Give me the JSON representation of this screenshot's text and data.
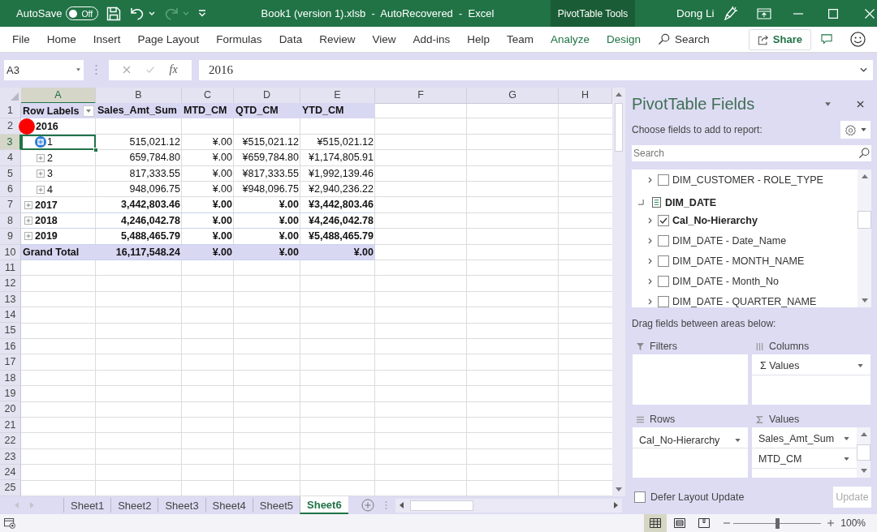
{
  "title_bar": {
    "autosave": {
      "label": "AutoSave",
      "toggle": "Off",
      "on": false
    },
    "quick_access": [
      {
        "kind": "save",
        "disabled": false
      },
      {
        "kind": "undo",
        "disabled": false
      },
      {
        "kind": "redo",
        "disabled": true
      },
      {
        "kind": "customize",
        "disabled": false
      }
    ],
    "document_title": "Book1 (version 1).xlsb  -  AutoRecovered  -  Excel",
    "context_tab": "PivotTable Tools",
    "user": "Dong Li"
  },
  "ribbon": {
    "tabs": [
      {
        "label": "File",
        "contextual": false
      },
      {
        "label": "Home",
        "contextual": false
      },
      {
        "label": "Insert",
        "contextual": false
      },
      {
        "label": "Page Layout",
        "contextual": false
      },
      {
        "label": "Formulas",
        "contextual": false
      },
      {
        "label": "Data",
        "contextual": false
      },
      {
        "label": "Review",
        "contextual": false
      },
      {
        "label": "View",
        "contextual": false
      },
      {
        "label": "Add-ins",
        "contextual": false
      },
      {
        "label": "Help",
        "contextual": false
      },
      {
        "label": "Team",
        "contextual": false
      },
      {
        "label": "Analyze",
        "contextual": true
      },
      {
        "label": "Design",
        "contextual": true
      }
    ],
    "search": "Search",
    "share": "Share"
  },
  "formula_bar": {
    "name_box": "A3",
    "function_button": "fx",
    "formula": "2016"
  },
  "sheet": {
    "columns": [
      {
        "label": "A",
        "selected": true
      },
      {
        "label": "B",
        "selected": false
      },
      {
        "label": "C",
        "selected": false
      },
      {
        "label": "D",
        "selected": false
      },
      {
        "label": "E",
        "selected": false
      },
      {
        "label": "F",
        "selected": false
      },
      {
        "label": "G",
        "selected": false
      },
      {
        "label": "H",
        "selected": false
      }
    ],
    "rows": [
      {
        "number": "1",
        "selected": false,
        "kind": "header",
        "label": "Row Labels",
        "values": [
          "Sales_Amt_Sum",
          "MTD_CM",
          "QTD_CM",
          "YTD_CM"
        ]
      },
      {
        "number": "2",
        "selected": false,
        "kind": "year",
        "label": "2016",
        "click_marker": true
      },
      {
        "number": "3",
        "selected": true,
        "kind": "quarter",
        "label": "1",
        "expanded": false,
        "hovered": true,
        "values": [
          "515,021.12",
          "¥.00",
          "¥515,021.12",
          "¥515,021.12"
        ]
      },
      {
        "number": "4",
        "selected": false,
        "kind": "quarter",
        "label": "2",
        "expanded": false,
        "hovered": false,
        "values": [
          "659,784.80",
          "¥.00",
          "¥659,784.80",
          "¥1,174,805.91"
        ]
      },
      {
        "number": "5",
        "selected": false,
        "kind": "quarter",
        "label": "3",
        "expanded": false,
        "hovered": false,
        "values": [
          "817,333.55",
          "¥.00",
          "¥817,333.55",
          "¥1,992,139.46"
        ]
      },
      {
        "number": "6",
        "selected": false,
        "kind": "quarter",
        "label": "4",
        "expanded": false,
        "hovered": false,
        "values": [
          "948,096.75",
          "¥.00",
          "¥948,096.75",
          "¥2,940,236.22"
        ]
      },
      {
        "number": "7",
        "selected": false,
        "kind": "year",
        "label": "2017",
        "expanded": false,
        "hovered": false,
        "values": [
          "3,442,803.46",
          "¥.00",
          "¥.00",
          "¥3,442,803.46"
        ]
      },
      {
        "number": "8",
        "selected": false,
        "kind": "year",
        "label": "2018",
        "expanded": false,
        "hovered": false,
        "values": [
          "4,246,042.78",
          "¥.00",
          "¥.00",
          "¥4,246,042.78"
        ]
      },
      {
        "number": "9",
        "selected": false,
        "kind": "year",
        "label": "2019",
        "expanded": false,
        "hovered": false,
        "values": [
          "5,488,465.79",
          "¥.00",
          "¥.00",
          "¥5,488,465.79"
        ]
      },
      {
        "number": "10",
        "selected": false,
        "kind": "total",
        "label": "Grand Total",
        "values": [
          "16,117,548.24",
          "¥.00",
          "¥.00",
          "¥.00"
        ]
      },
      {
        "number": "11",
        "selected": false,
        "kind": "empty"
      },
      {
        "number": "12",
        "selected": false,
        "kind": "empty"
      },
      {
        "number": "13",
        "selected": false,
        "kind": "empty"
      },
      {
        "number": "14",
        "selected": false,
        "kind": "empty"
      },
      {
        "number": "15",
        "selected": false,
        "kind": "empty"
      },
      {
        "number": "16",
        "selected": false,
        "kind": "empty"
      },
      {
        "number": "17",
        "selected": false,
        "kind": "empty"
      },
      {
        "number": "18",
        "selected": false,
        "kind": "empty"
      },
      {
        "number": "19",
        "selected": false,
        "kind": "empty"
      },
      {
        "number": "20",
        "selected": false,
        "kind": "empty"
      },
      {
        "number": "21",
        "selected": false,
        "kind": "empty"
      },
      {
        "number": "22",
        "selected": false,
        "kind": "empty"
      },
      {
        "number": "23",
        "selected": false,
        "kind": "empty"
      },
      {
        "number": "24",
        "selected": false,
        "kind": "empty"
      },
      {
        "number": "25",
        "selected": false,
        "kind": "empty"
      }
    ]
  },
  "sheet_tabs": [
    {
      "label": "Sheet1",
      "selected": false
    },
    {
      "label": "Sheet2",
      "selected": false
    },
    {
      "label": "Sheet3",
      "selected": false
    },
    {
      "label": "Sheet4",
      "selected": false
    },
    {
      "label": "Sheet5",
      "selected": false
    },
    {
      "label": "Sheet6",
      "selected": true
    }
  ],
  "pivot_pane": {
    "title": "PivotTable Fields",
    "subtitle": "Choose fields to add to report:",
    "search_placeholder": "Search",
    "fields": [
      {
        "kind": "field",
        "label": "DIM_CUSTOMER - ROLE_TYPE",
        "checked": false
      },
      {
        "kind": "table",
        "label": "DIM_DATE",
        "expanded": true,
        "children": [
          {
            "label": "Cal_No-Hierarchy",
            "checked": true
          },
          {
            "label": "DIM_DATE - Date_Name",
            "checked": false
          },
          {
            "label": "DIM_DATE - MONTH_NAME",
            "checked": false
          },
          {
            "label": "DIM_DATE - Month_No",
            "checked": false
          },
          {
            "label": "DIM_DATE - QUARTER_NAME",
            "checked": false
          }
        ]
      }
    ],
    "areas_hint": "Drag fields between areas below:",
    "areas": [
      {
        "kind": "filters",
        "label": "Filters"
      },
      {
        "kind": "columns",
        "label": "Columns",
        "items": [
          "Σ Values"
        ]
      },
      {
        "kind": "rows",
        "label": "Rows",
        "items": [
          "Cal_No-Hierarchy"
        ]
      },
      {
        "kind": "values",
        "label": "Values",
        "items": [
          "Sales_Amt_Sum",
          "MTD_CM"
        ]
      }
    ],
    "defer": {
      "label": "Defer Layout Update",
      "checked": false
    },
    "update_button": {
      "label": "Update",
      "disabled": true
    }
  },
  "status_bar": {
    "views": [
      {
        "kind": "normal",
        "selected": true
      },
      {
        "kind": "page_layout",
        "selected": false
      },
      {
        "kind": "page_break_preview",
        "selected": false
      }
    ],
    "zoom": {
      "level": 0.5,
      "label": "100%"
    }
  }
}
